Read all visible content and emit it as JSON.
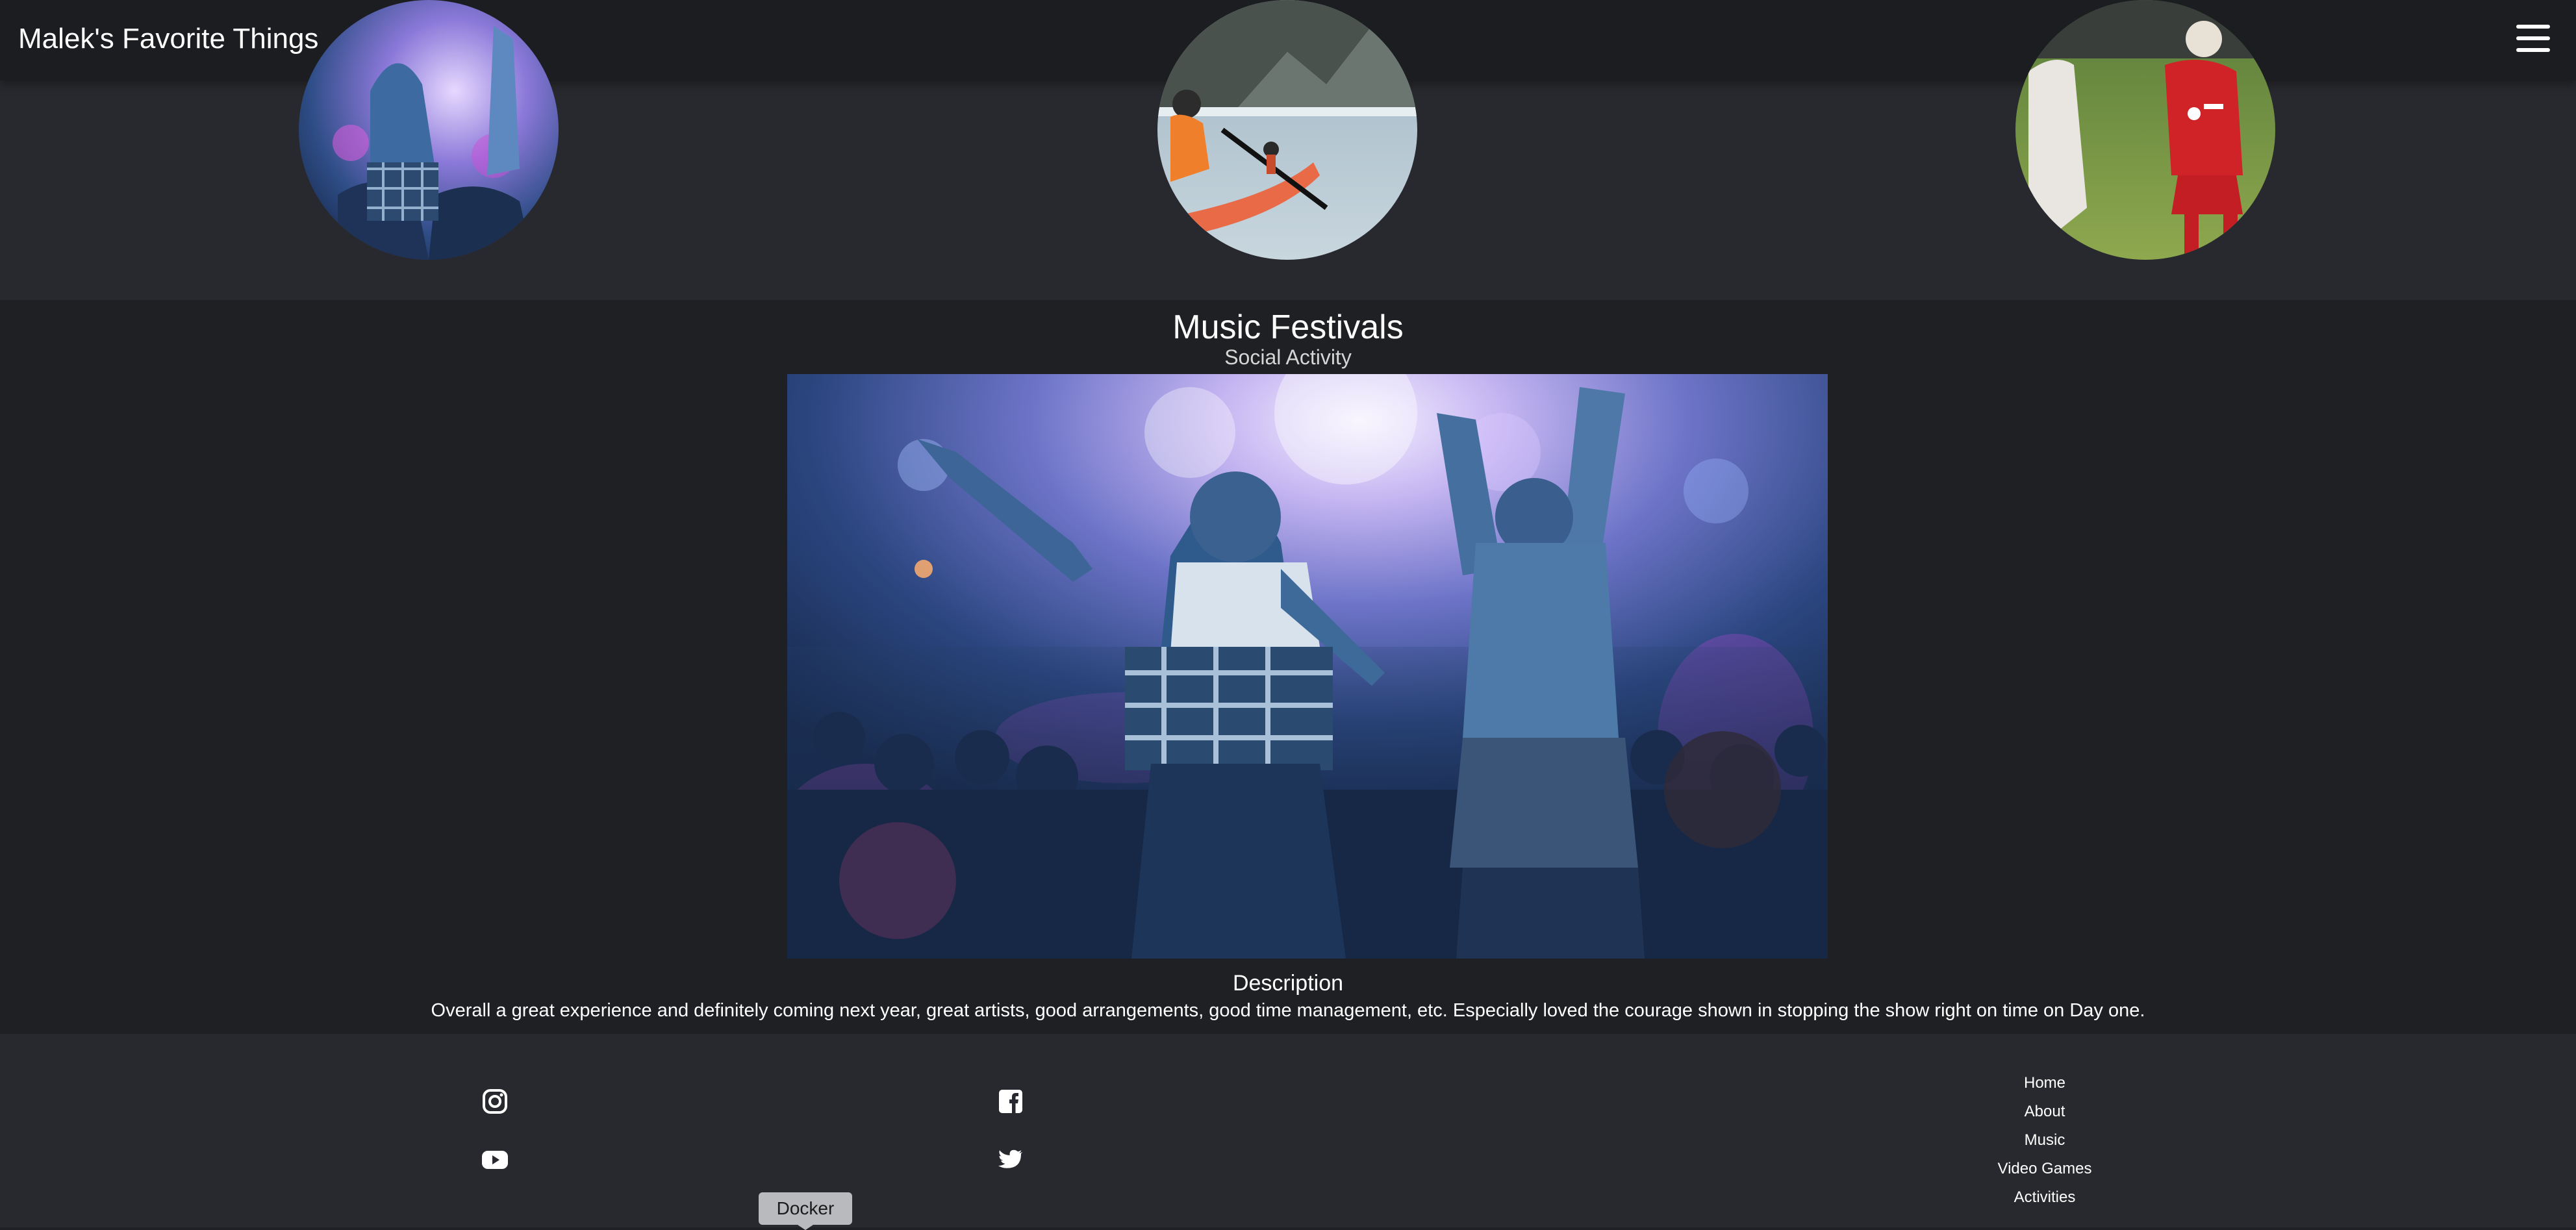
{
  "header": {
    "title": "Malek's Favorite Things",
    "menu_icon": "hamburger-menu-icon"
  },
  "thumbnails": [
    {
      "subject": "music festival crowd",
      "icon": "image"
    },
    {
      "subject": "kayaking on glacier lake",
      "icon": "image"
    },
    {
      "subject": "soccer match",
      "icon": "image"
    }
  ],
  "main": {
    "title": "Music Festivals",
    "subtitle": "Social Activity",
    "description_label": "Description",
    "description_text": "Overall a great experience and definitely coming next year, great artists, good arrangements, good time management, etc. Especially loved the courage shown in stopping the show right on time on Day one."
  },
  "footer": {
    "social_icons": [
      "instagram-icon",
      "facebook-icon",
      "youtube-icon",
      "twitter-icon"
    ],
    "nav": [
      "Home",
      "About",
      "Music",
      "Video Games",
      "Activities"
    ],
    "tooltip": "Docker"
  },
  "colors": {
    "header_bg": "#1c1d21",
    "band_bg": "#28292e",
    "main_bg": "#1f2024",
    "footer_bg": "#28292e",
    "text": "#ffffff",
    "tooltip_bg": "#b9babd"
  }
}
